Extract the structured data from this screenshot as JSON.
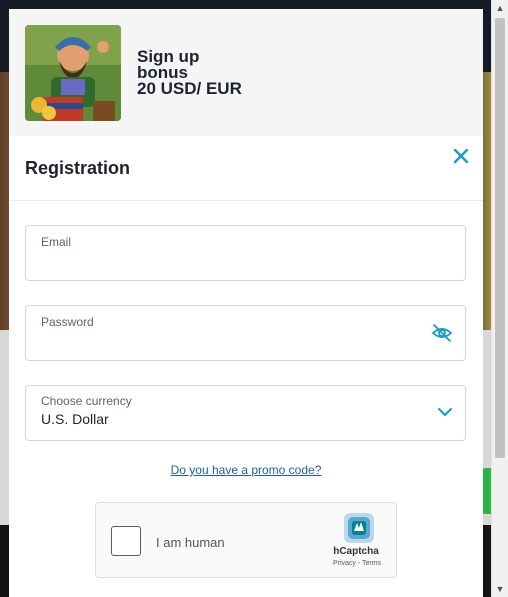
{
  "banner": {
    "bonus_text": "Sign up\nbonus\n20 USD/ EUR"
  },
  "modal": {
    "title": "Registration"
  },
  "form": {
    "email": {
      "label": "Email",
      "value": ""
    },
    "password": {
      "label": "Password",
      "value": ""
    },
    "currency": {
      "label": "Choose currency",
      "value": "U.S. Dollar"
    },
    "promo_link": "Do you have a promo code?"
  },
  "captcha": {
    "label": "I am human",
    "brand": "hCaptcha",
    "links": "Privacy - Terms"
  },
  "colors": {
    "accent": "#1a9bc4",
    "title_text": "#1e2230",
    "banner_bg": "#f5f5f5"
  },
  "icons": {
    "close": "close-icon",
    "eye": "eye-off-icon",
    "chevron": "chevron-down-icon",
    "captcha_logo": "hcaptcha-logo-icon"
  }
}
